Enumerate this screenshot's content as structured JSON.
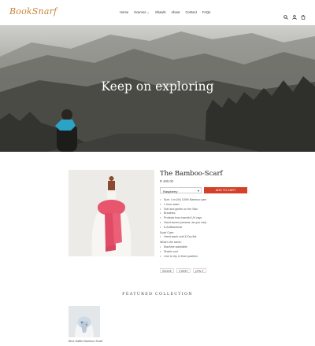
{
  "header": {
    "logo": "BookSnarf",
    "nav": [
      "Home",
      "Scarves ⌄",
      "Shawls",
      "About",
      "Contact",
      "FAQs"
    ],
    "icons": [
      "search-icon",
      "user-icon",
      "cart-icon"
    ]
  },
  "hero": {
    "title": "Keep on exploring",
    "slides": 3,
    "active_slide": 1
  },
  "product": {
    "title": "The Bamboo-Scarf",
    "price": "R 400.00",
    "variant": "Raspberry",
    "add_to_cart": "ADD TO CART",
    "features": [
      "Size: 4 m (W) 100% Bamboo yarn",
      "1 hour wash",
      "Soft and gentle on the Skin",
      "Breathes",
      "Protects from harmful UV rays",
      "Hand woven (weaver, as you can)",
      "& Antibacterial"
    ],
    "scarf_care_head": "Scarf Care:",
    "scarf_care": [
      "Hand wash cold & Dry flat"
    ],
    "other_head": "What's the same:",
    "other": [
      "Machine washable",
      "Shade cool",
      "Line to dry in fresh position"
    ],
    "share": [
      "SHARE",
      "TWEET",
      "PIN IT"
    ]
  },
  "featured": {
    "heading": "FEATURED COLLECTION",
    "items": [
      {
        "title": "Blue Saffie Bamboo Scarf"
      }
    ]
  },
  "colors": {
    "brand": "#c8843a",
    "accent": "#d4412a",
    "scarf": "#e8566e"
  }
}
